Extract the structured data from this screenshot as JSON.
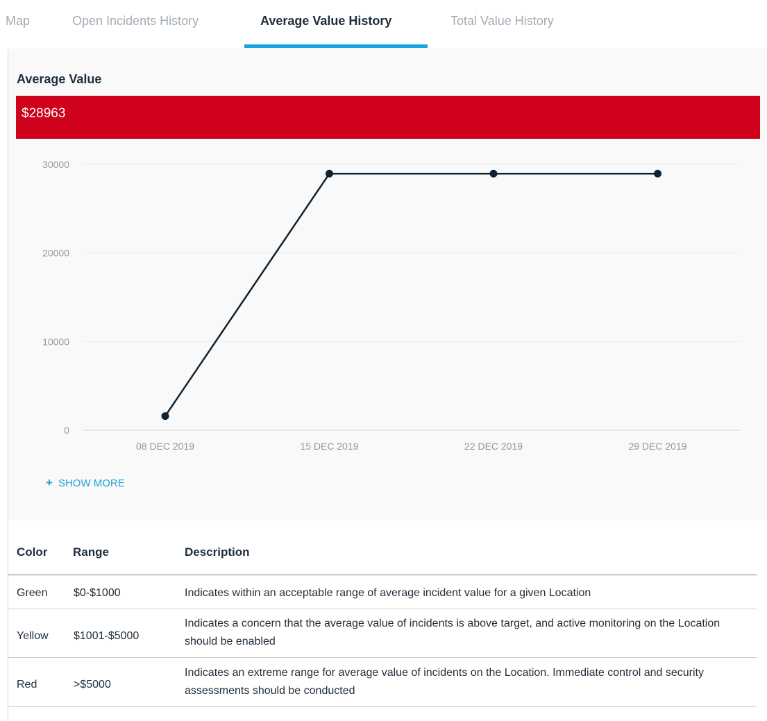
{
  "tabs": [
    {
      "label": "Map"
    },
    {
      "label": "Open Incidents History"
    },
    {
      "label": "Average Value History",
      "active": true
    },
    {
      "label": "Total Value History"
    }
  ],
  "widget": {
    "title": "Average Value",
    "value": "$28963",
    "value_color": "#d0021b",
    "show_more": "SHOW MORE"
  },
  "chart_data": {
    "type": "line",
    "x": [
      "08 DEC 2019",
      "15 DEC 2019",
      "22 DEC 2019",
      "29 DEC 2019"
    ],
    "y": [
      1600,
      28963,
      28963,
      28963
    ],
    "ylim": [
      0,
      30000
    ],
    "yticks": [
      "0",
      "10000",
      "20000",
      "30000"
    ],
    "grid": true,
    "line_color": "#0f2233"
  },
  "legend_table": {
    "headers": [
      "Color",
      "Range",
      "Description"
    ],
    "rows": [
      {
        "color": "Green",
        "range": "$0-$1000",
        "description": "Indicates within an acceptable range of average incident value for a given Location"
      },
      {
        "color": "Yellow",
        "range": "$1001-$5000",
        "description": "Indicates a concern that the average value of incidents is above target, and active monitoring on the Location should be enabled"
      },
      {
        "color": "Red",
        "range": ">$5000",
        "description": "Indicates an extreme range for average value of incidents on the Location. Immediate control and security assessments should be conducted"
      }
    ]
  }
}
